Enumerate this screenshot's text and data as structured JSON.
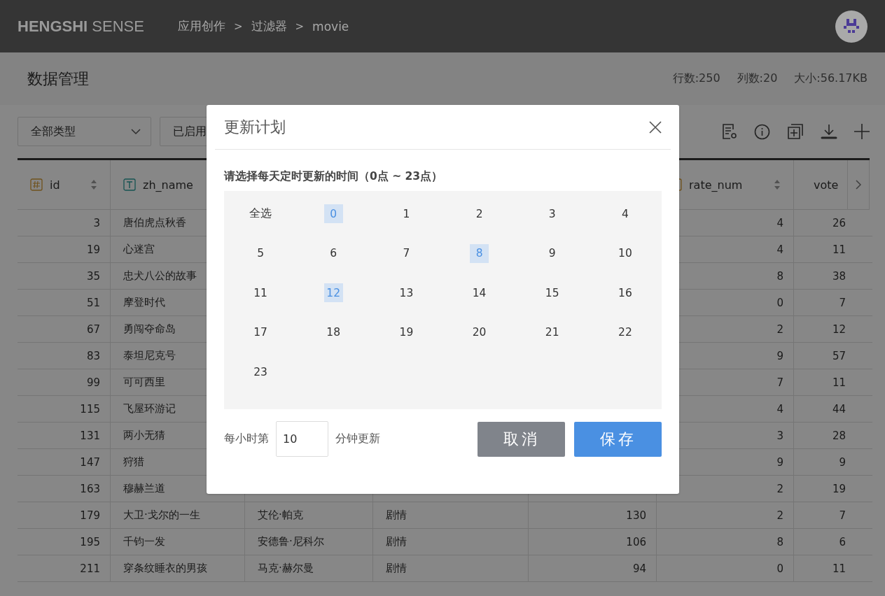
{
  "header": {
    "logo_bold": "HENGSHI",
    "logo_light": "SENSE",
    "breadcrumb": [
      "应用创作",
      "过滤器",
      "movie"
    ],
    "breadcrumb_separator": ">"
  },
  "subheader": {
    "title": "数据管理",
    "stats": [
      "行数:250",
      "列数:20",
      "大小:56.17KB"
    ]
  },
  "toolbar": {
    "dropdowns": [
      "全部类型",
      "已启用"
    ]
  },
  "table": {
    "columns": [
      {
        "label": "id",
        "kind": "number",
        "sortable": true
      },
      {
        "label": "zh_name",
        "kind": "text"
      },
      {
        "label": "rate_num",
        "kind": "number",
        "sortable": true
      },
      {
        "label": "vote",
        "kind": "number"
      }
    ],
    "rows": [
      {
        "id": "3",
        "zh_name": "唐伯虎点秋香",
        "rate_num": "4",
        "vote": "26"
      },
      {
        "id": "19",
        "zh_name": "心迷宫",
        "rate_num": "4",
        "vote": "11"
      },
      {
        "id": "35",
        "zh_name": "忠犬八公的故事",
        "rate_num": "8",
        "vote": "38"
      },
      {
        "id": "51",
        "zh_name": "摩登时代",
        "rate_num": "0",
        "vote": "7"
      },
      {
        "id": "67",
        "zh_name": "勇闯夺命岛",
        "rate_num": "2",
        "vote": "12"
      },
      {
        "id": "83",
        "zh_name": "泰坦尼克号",
        "rate_num": "9",
        "vote": "57"
      },
      {
        "id": "99",
        "zh_name": "可可西里",
        "rate_num": "7",
        "vote": "11"
      },
      {
        "id": "115",
        "zh_name": "飞屋环游记",
        "rate_num": "4",
        "vote": "44"
      },
      {
        "id": "131",
        "zh_name": "两小无猜",
        "rate_num": "3",
        "vote": "28"
      },
      {
        "id": "147",
        "zh_name": "狩猎",
        "rate_num": "9",
        "vote": "9"
      },
      {
        "id": "163",
        "zh_name": "穆赫兰道",
        "rate_num": "2",
        "vote": "19"
      },
      {
        "id": "179",
        "zh_name": "大卫·戈尔的一生",
        "column_3": "艾伦·帕克",
        "column_4": "剧情",
        "column_5": "130",
        "rate_num": "2",
        "vote": "7"
      },
      {
        "id": "195",
        "zh_name": "千钧一发",
        "column_3": "安德鲁·尼科尔",
        "column_4": "剧情",
        "column_5": "106",
        "rate_num": "8",
        "vote": "6"
      },
      {
        "id": "211",
        "zh_name": "穿条纹睡衣的男孩",
        "column_3": "马克·赫尔曼",
        "column_4": "剧情",
        "column_5": "94",
        "rate_num": "0",
        "vote": "11"
      }
    ]
  },
  "dialog": {
    "title": "更新计划",
    "prompt": "请选择每天定时更新的时间（0点 ~ 23点）",
    "select_all": "全选",
    "hours": [
      {
        "label": "0",
        "selected": true
      },
      {
        "label": "1",
        "selected": false
      },
      {
        "label": "2",
        "selected": false
      },
      {
        "label": "3",
        "selected": false
      },
      {
        "label": "4",
        "selected": false
      },
      {
        "label": "5",
        "selected": false
      },
      {
        "label": "6",
        "selected": false
      },
      {
        "label": "7",
        "selected": false
      },
      {
        "label": "8",
        "selected": true
      },
      {
        "label": "9",
        "selected": false
      },
      {
        "label": "10",
        "selected": false
      },
      {
        "label": "11",
        "selected": false
      },
      {
        "label": "12",
        "selected": true
      },
      {
        "label": "13",
        "selected": false
      },
      {
        "label": "14",
        "selected": false
      },
      {
        "label": "15",
        "selected": false
      },
      {
        "label": "16",
        "selected": false
      },
      {
        "label": "17",
        "selected": false
      },
      {
        "label": "18",
        "selected": false
      },
      {
        "label": "19",
        "selected": false
      },
      {
        "label": "20",
        "selected": false
      },
      {
        "label": "21",
        "selected": false
      },
      {
        "label": "22",
        "selected": false
      },
      {
        "label": "23",
        "selected": false
      }
    ],
    "minute_prefix": "每小时第",
    "minute_value": "10",
    "minute_suffix": "分钟更新",
    "cancel": "取消",
    "save": "保存"
  }
}
